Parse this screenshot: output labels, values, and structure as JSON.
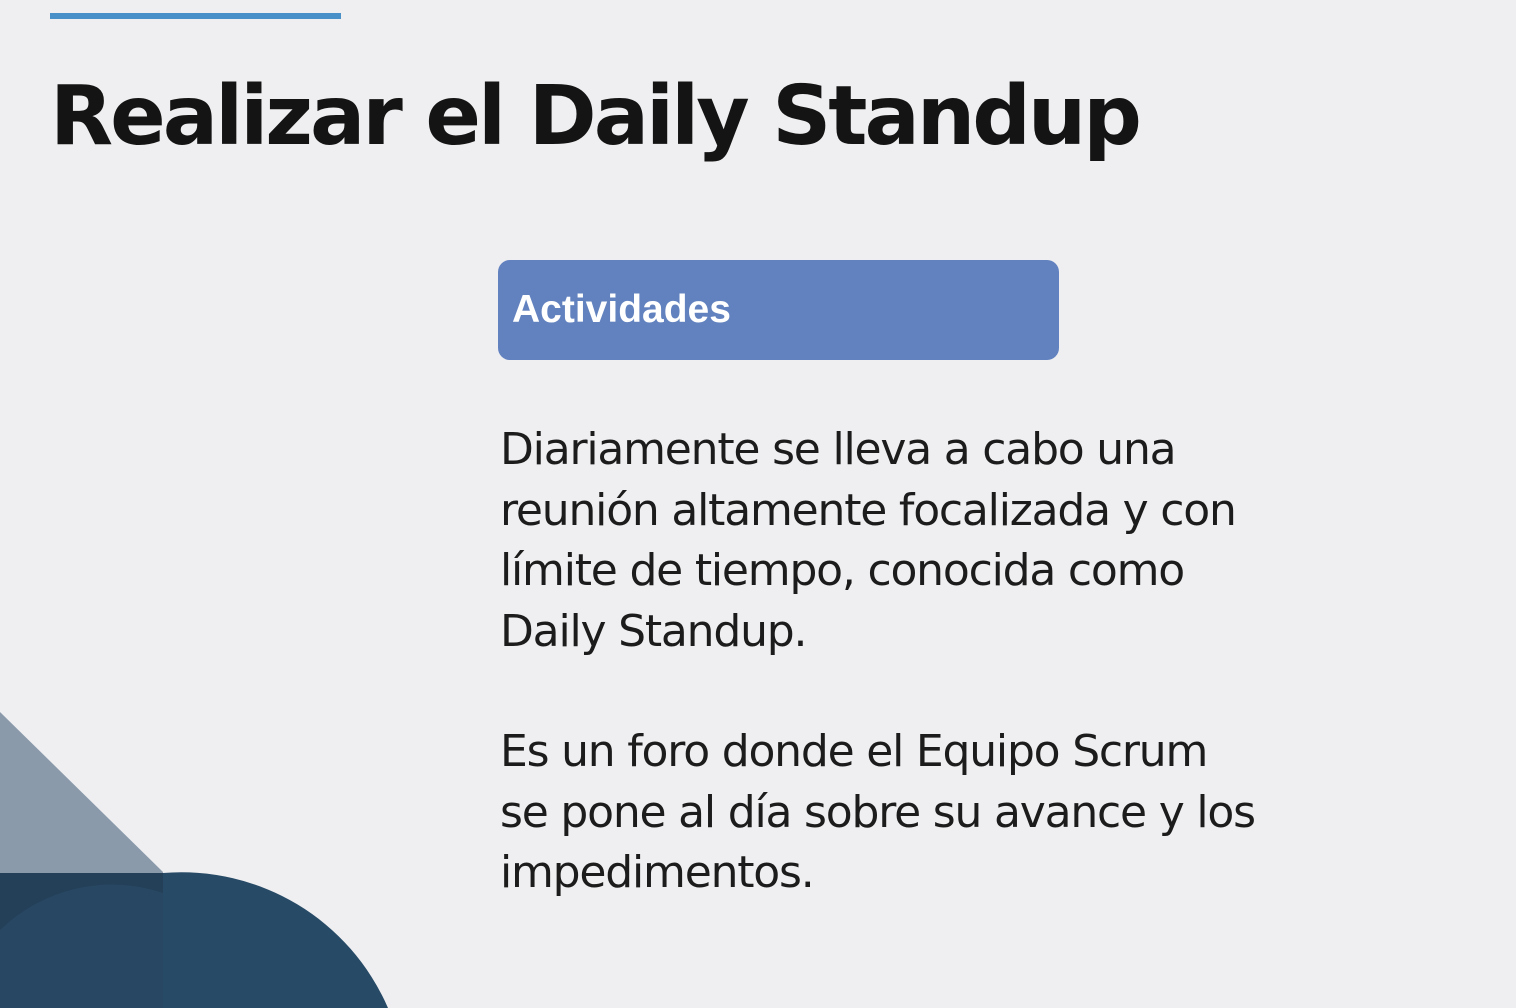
{
  "slide": {
    "title": "Realizar el Daily Standup",
    "section_header": "Actividades",
    "paragraph_1": {
      "lines": [
        "Diariamente se lleva a cabo una",
        "reunión altamente focalizada y con",
        "límite de tiempo, conocida como",
        "Daily Standup."
      ]
    },
    "paragraph_2": {
      "lines": [
        "Es un foro donde el Equipo Scrum",
        "se pone al día sobre su avance y los",
        "impedimentos."
      ]
    }
  },
  "colors": {
    "background": "#efeff1",
    "accent_line": "#4a90c8",
    "header_box": "#6282bf",
    "title_text": "#141414",
    "decor_light": "#8a9aab",
    "decor_dark": "#274a66"
  }
}
